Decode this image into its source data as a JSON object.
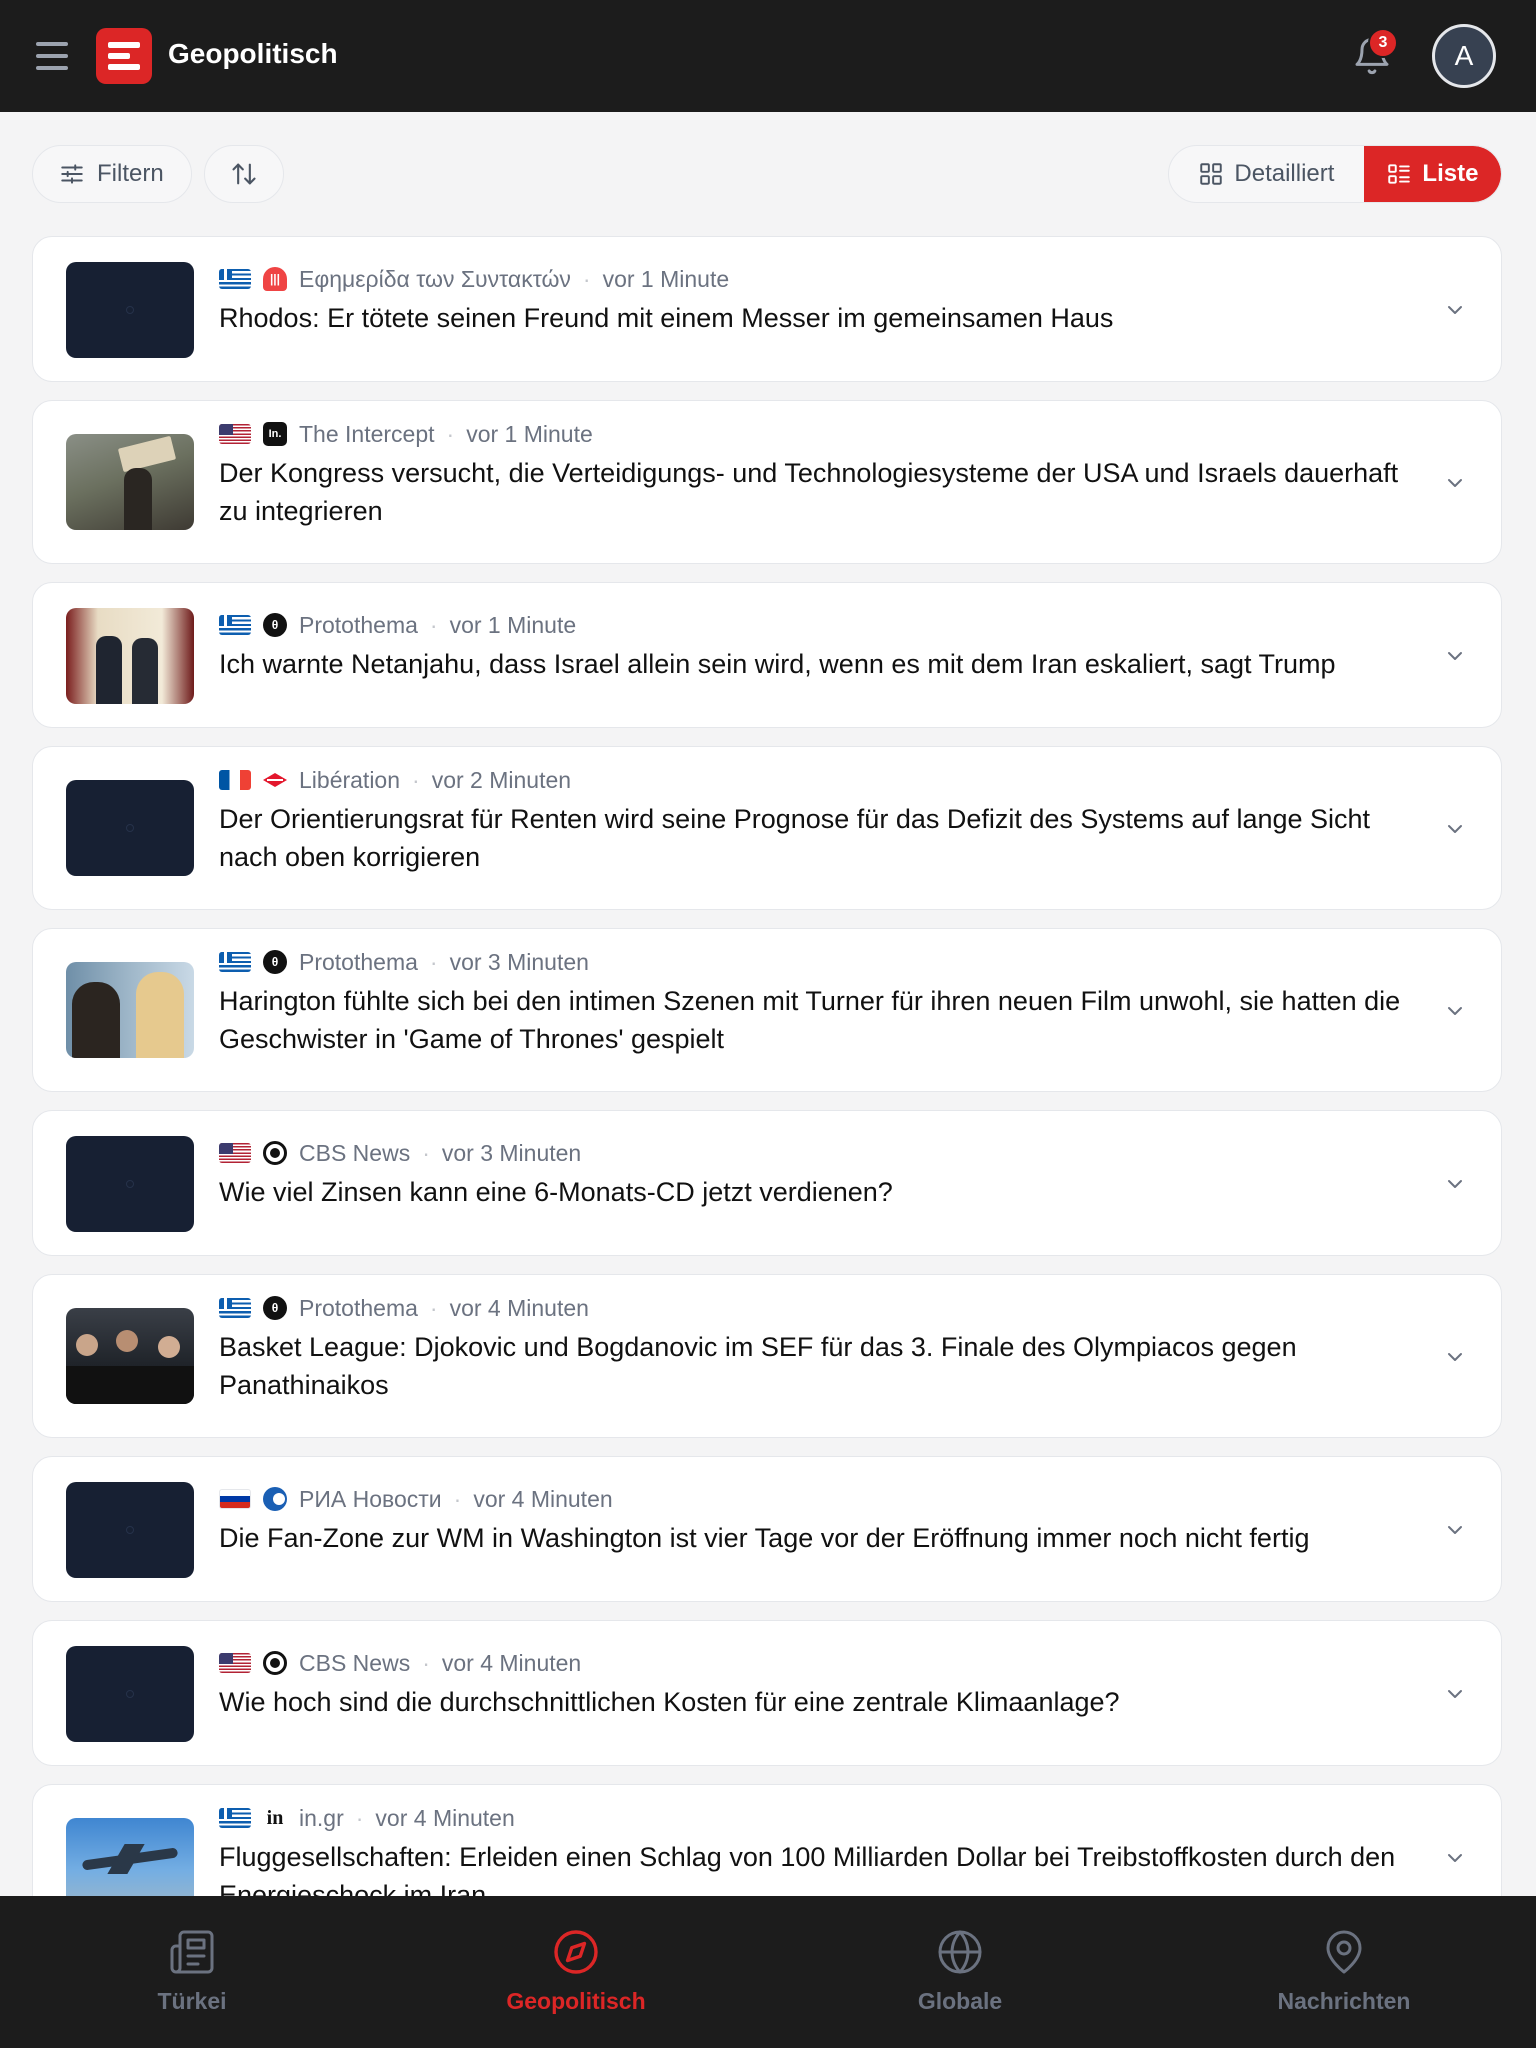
{
  "header": {
    "app_title": "Geopolitisch",
    "notification_count": "3",
    "avatar_initial": "A",
    "brand_color": "#dc2626"
  },
  "toolbar": {
    "filter_label": "Filtern",
    "sort_icon": "sort-arrows-icon",
    "view_detail_label": "Detailliert",
    "view_list_label": "Liste",
    "active_view": "Liste"
  },
  "articles": [
    {
      "flag": "Greece",
      "source_icon": "efsyn-logo",
      "source": "Εφημερίδα των Συντακτών",
      "time": "vor 1 Minute",
      "title": "Rhodos: Er tötete seinen Freund mit einem Messer im gemeinsamen Haus",
      "has_image": false
    },
    {
      "flag": "USA",
      "source_icon": "the-intercept-logo",
      "source": "The Intercept",
      "time": "vor 1 Minute",
      "title": "Der Kongress versucht, die Verteidigungs- und Technologiesysteme der USA und Israels dauerhaft zu integrieren",
      "has_image": true
    },
    {
      "flag": "Greece",
      "source_icon": "protothema-logo",
      "source": "Protothema",
      "time": "vor 1 Minute",
      "title": "Ich warnte Netanjahu, dass Israel allein sein wird, wenn es mit dem Iran eskaliert, sagt Trump",
      "has_image": true
    },
    {
      "flag": "France",
      "source_icon": "liberation-logo",
      "source": "Libération",
      "time": "vor 2 Minuten",
      "title": "Der Orientierungsrat für Renten wird seine Prognose für das Defizit des Systems auf lange Sicht nach oben korrigieren",
      "has_image": false
    },
    {
      "flag": "Greece",
      "source_icon": "protothema-logo",
      "source": "Protothema",
      "time": "vor 3 Minuten",
      "title": "Harington fühlte sich bei den intimen Szenen mit Turner für ihren neuen Film unwohl, sie hatten die Geschwister in 'Game of Thrones' gespielt",
      "has_image": true
    },
    {
      "flag": "USA",
      "source_icon": "cbs-eye-logo",
      "source": "CBS News",
      "time": "vor 3 Minuten",
      "title": "Wie viel Zinsen kann eine 6-Monats-CD jetzt verdienen?",
      "has_image": false
    },
    {
      "flag": "Greece",
      "source_icon": "protothema-logo",
      "source": "Protothema",
      "time": "vor 4 Minuten",
      "title": "Basket League: Djokovic und Bogdanovic im SEF für das 3. Finale des Olympiacos gegen Panathinaikos",
      "has_image": true
    },
    {
      "flag": "Russia",
      "source_icon": "ria-novosti-logo",
      "source": "РИА Новости",
      "time": "vor 4 Minuten",
      "title": "Die Fan-Zone zur WM in Washington ist vier Tage vor der Eröffnung immer noch nicht fertig",
      "has_image": false
    },
    {
      "flag": "USA",
      "source_icon": "cbs-eye-logo",
      "source": "CBS News",
      "time": "vor 4 Minuten",
      "title": "Wie hoch sind die durchschnittlichen Kosten für eine zentrale Klimaanlage?",
      "has_image": false
    },
    {
      "flag": "Greece",
      "source_icon": "in-gr-logo",
      "source": "in.gr",
      "time": "vor 4 Minuten",
      "title": "Fluggesellschaften: Erleiden einen Schlag von 100 Milliarden Dollar bei Treibstoffkosten durch den Energieschock im Iran",
      "has_image": true
    }
  ],
  "bottom_nav": [
    {
      "label": "Türkei",
      "icon": "newspaper-icon",
      "active": false
    },
    {
      "label": "Geopolitisch",
      "icon": "compass-icon",
      "active": true
    },
    {
      "label": "Globale",
      "icon": "globe-icon",
      "active": false
    },
    {
      "label": "Nachrichten",
      "icon": "map-pin-icon",
      "active": false
    }
  ]
}
